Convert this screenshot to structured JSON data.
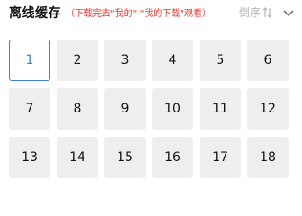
{
  "header": {
    "title": "离线缓存",
    "hint": "（下载完去\"我的\"-\"我的下载\"观看）",
    "sort_label": "倒序"
  },
  "icons": {
    "sort": "sort-arrows-icon",
    "collapse": "chevron-down-icon"
  },
  "colors": {
    "accent": "#3d7fd6",
    "hint_red": "#e8342d",
    "tile_bg": "#eeeeee"
  },
  "episodes": [
    {
      "label": "1",
      "selected": true
    },
    {
      "label": "2",
      "selected": false
    },
    {
      "label": "3",
      "selected": false
    },
    {
      "label": "4",
      "selected": false
    },
    {
      "label": "5",
      "selected": false
    },
    {
      "label": "6",
      "selected": false
    },
    {
      "label": "7",
      "selected": false
    },
    {
      "label": "8",
      "selected": false
    },
    {
      "label": "9",
      "selected": false
    },
    {
      "label": "10",
      "selected": false
    },
    {
      "label": "11",
      "selected": false
    },
    {
      "label": "12",
      "selected": false
    },
    {
      "label": "13",
      "selected": false
    },
    {
      "label": "14",
      "selected": false
    },
    {
      "label": "15",
      "selected": false
    },
    {
      "label": "16",
      "selected": false
    },
    {
      "label": "17",
      "selected": false
    },
    {
      "label": "18",
      "selected": false
    }
  ]
}
